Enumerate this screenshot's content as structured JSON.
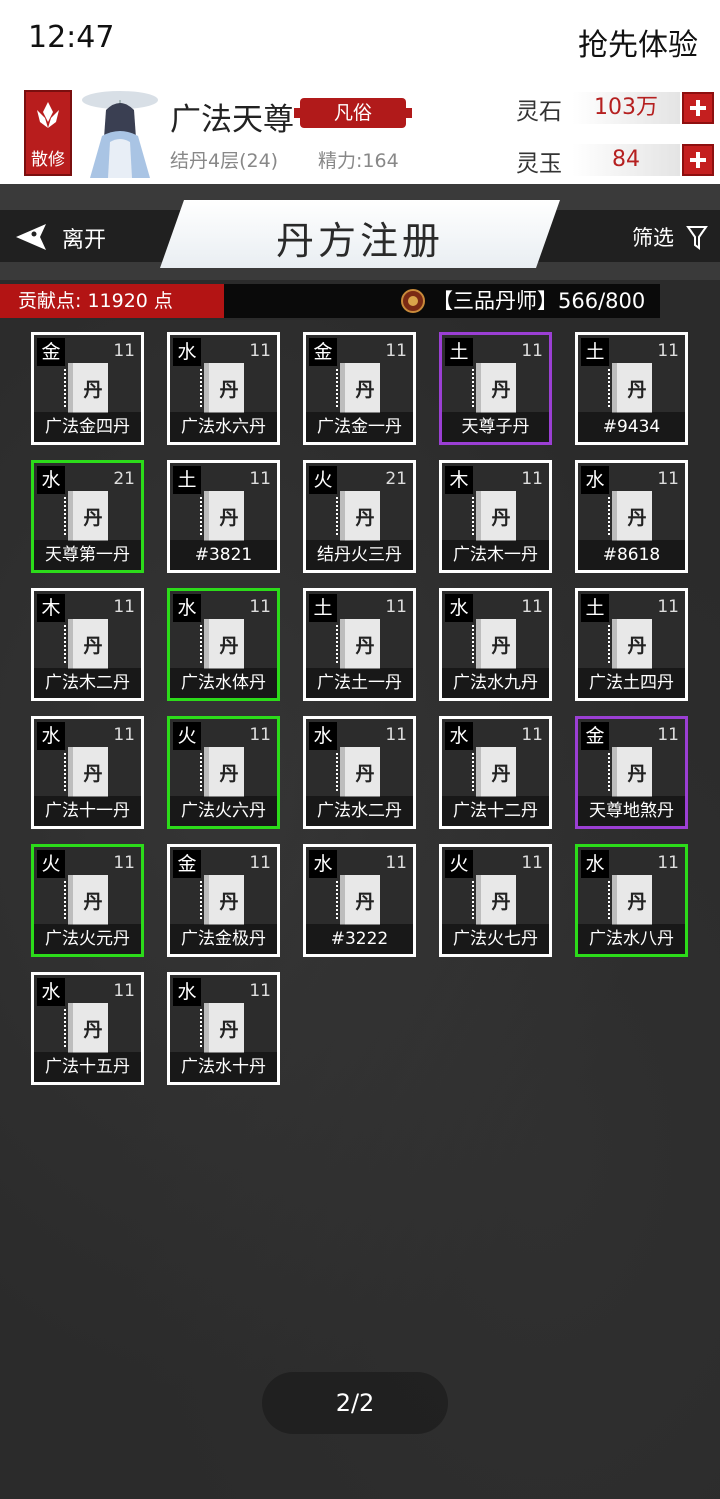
{
  "status_bar": {
    "time": "12:47",
    "trial": "抢先体验"
  },
  "profile": {
    "sect": "散修",
    "name": "广法天尊",
    "rank": "凡俗",
    "realm": "结丹4层(24)",
    "energy": "精力:164",
    "currencies": [
      {
        "label": "灵石",
        "value": "103万"
      },
      {
        "label": "灵玉",
        "value": "84"
      }
    ]
  },
  "header": {
    "leave": "离开",
    "title": "丹方注册",
    "filter": "筛选"
  },
  "contribution": {
    "text": "贡献点: 11920 点"
  },
  "alchemist": {
    "text": "【三品丹师】566/800"
  },
  "colors": {
    "green_border": "#2cdb1a",
    "purple_border": "#9b3fd4",
    "accent_red": "#b31414"
  },
  "book_char": "丹",
  "cards": [
    {
      "element": "金",
      "level": "11",
      "name": "广法金四丹",
      "border": "white"
    },
    {
      "element": "水",
      "level": "11",
      "name": "广法水六丹",
      "border": "white"
    },
    {
      "element": "金",
      "level": "11",
      "name": "广法金一丹",
      "border": "white"
    },
    {
      "element": "土",
      "level": "11",
      "name": "天尊子丹",
      "border": "purple"
    },
    {
      "element": "土",
      "level": "11",
      "name": "#9434",
      "border": "white"
    },
    {
      "element": "水",
      "level": "21",
      "name": "天尊第一丹",
      "border": "green"
    },
    {
      "element": "土",
      "level": "11",
      "name": "#3821",
      "border": "white"
    },
    {
      "element": "火",
      "level": "21",
      "name": "结丹火三丹",
      "border": "white"
    },
    {
      "element": "木",
      "level": "11",
      "name": "广法木一丹",
      "border": "white"
    },
    {
      "element": "水",
      "level": "11",
      "name": "#8618",
      "border": "white"
    },
    {
      "element": "木",
      "level": "11",
      "name": "广法木二丹",
      "border": "white"
    },
    {
      "element": "水",
      "level": "11",
      "name": "广法水体丹",
      "border": "green"
    },
    {
      "element": "土",
      "level": "11",
      "name": "广法土一丹",
      "border": "white"
    },
    {
      "element": "水",
      "level": "11",
      "name": "广法水九丹",
      "border": "white"
    },
    {
      "element": "土",
      "level": "11",
      "name": "广法土四丹",
      "border": "white"
    },
    {
      "element": "水",
      "level": "11",
      "name": "广法十一丹",
      "border": "white"
    },
    {
      "element": "火",
      "level": "11",
      "name": "广法火六丹",
      "border": "green"
    },
    {
      "element": "水",
      "level": "11",
      "name": "广法水二丹",
      "border": "white"
    },
    {
      "element": "水",
      "level": "11",
      "name": "广法十二丹",
      "border": "white"
    },
    {
      "element": "金",
      "level": "11",
      "name": "天尊地煞丹",
      "border": "purple"
    },
    {
      "element": "火",
      "level": "11",
      "name": "广法火元丹",
      "border": "green"
    },
    {
      "element": "金",
      "level": "11",
      "name": "广法金极丹",
      "border": "white"
    },
    {
      "element": "水",
      "level": "11",
      "name": "#3222",
      "border": "white"
    },
    {
      "element": "火",
      "level": "11",
      "name": "广法火七丹",
      "border": "white"
    },
    {
      "element": "水",
      "level": "11",
      "name": "广法水八丹",
      "border": "green"
    },
    {
      "element": "水",
      "level": "11",
      "name": "广法十五丹",
      "border": "white"
    },
    {
      "element": "水",
      "level": "11",
      "name": "广法水十丹",
      "border": "white"
    }
  ],
  "pager": {
    "text": "2/2"
  }
}
